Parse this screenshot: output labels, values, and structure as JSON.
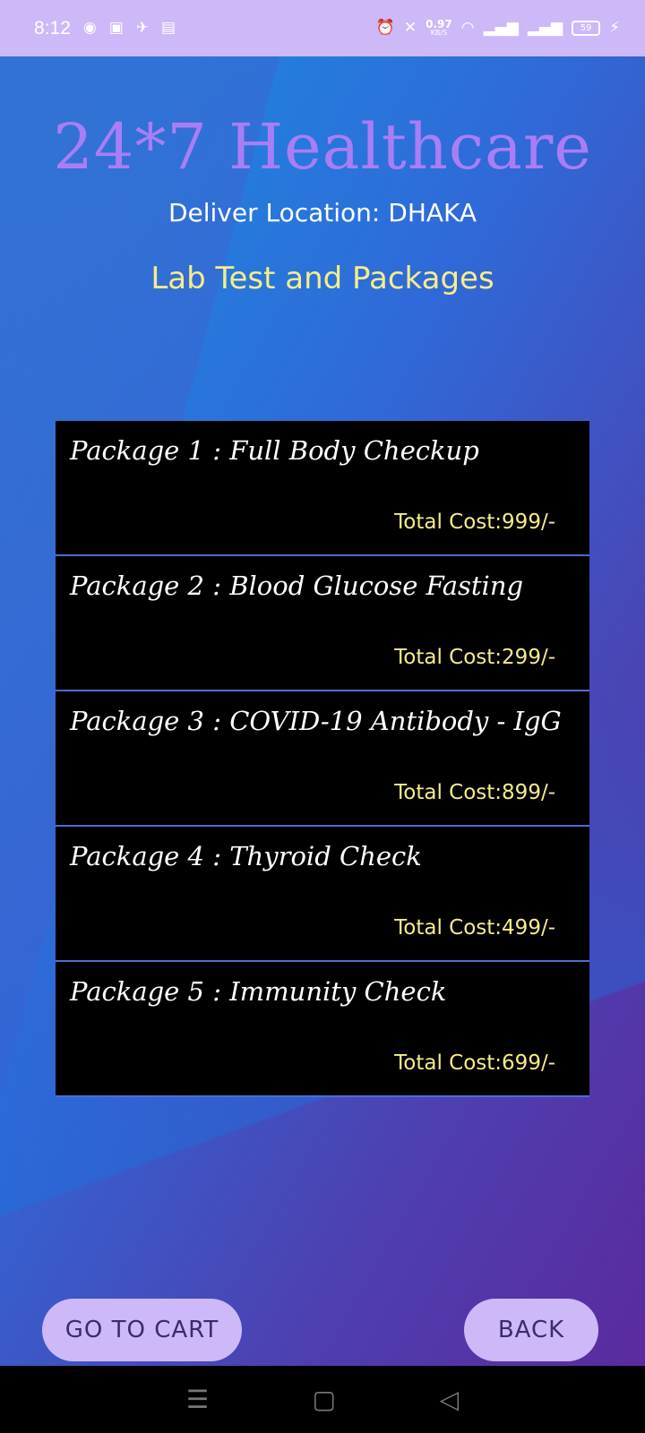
{
  "status_bar": {
    "time": "8:12",
    "left_icons": [
      "messenger-icon",
      "facebook-icon",
      "app-icon",
      "gallery-icon"
    ],
    "speed_value": "0.97",
    "speed_unit": "KB/S",
    "battery": "59"
  },
  "header": {
    "title": "24*7 Healthcare",
    "location": "Deliver Location: DHAKA",
    "section_title": "Lab Test and Packages"
  },
  "packages": [
    {
      "name": "Package 1 : Full Body Checkup",
      "cost": "Total Cost:999/-"
    },
    {
      "name": "Package 2 : Blood Glucose Fasting",
      "cost": "Total Cost:299/-"
    },
    {
      "name": "Package 3 : COVID-19 Antibody - IgG",
      "cost": "Total Cost:899/-"
    },
    {
      "name": "Package 4 : Thyroid Check",
      "cost": "Total Cost:499/-"
    },
    {
      "name": "Package 5 : Immunity Check",
      "cost": "Total Cost:699/-"
    }
  ],
  "buttons": {
    "cart": "GO TO CART",
    "back": "BACK"
  },
  "colors": {
    "accent_purple": "#a97ef5",
    "button_bg": "#cdb8f8",
    "cost_yellow": "#f7ec8a"
  }
}
